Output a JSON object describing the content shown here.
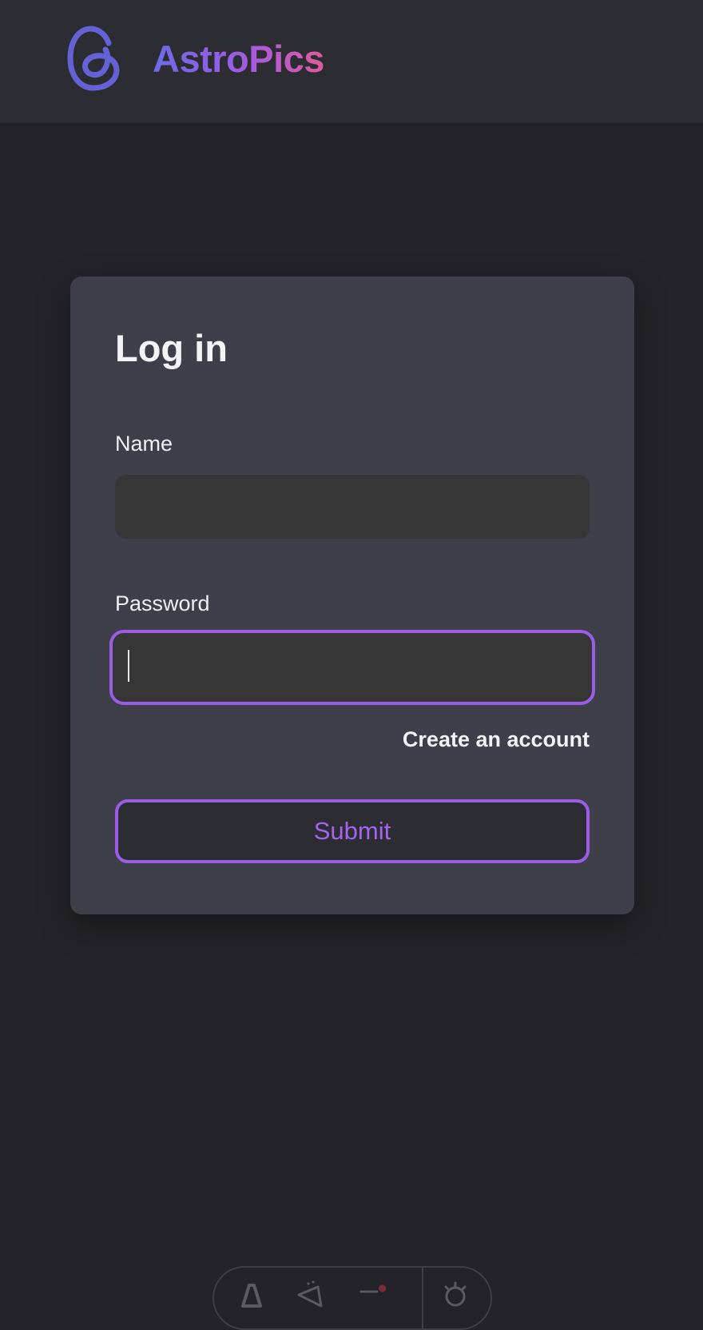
{
  "header": {
    "brand_name": "AstroPics",
    "logo_icon": "threads-at-icon",
    "brand_gradient": [
      "#6b6be6",
      "#a25be3",
      "#e05b9c"
    ]
  },
  "login": {
    "title": "Log in",
    "name_label": "Name",
    "name_value": "",
    "password_label": "Password",
    "password_value": "",
    "create_account_link": "Create an account",
    "submit_label": "Submit"
  },
  "toolbar": {
    "icons": [
      "astro-logo-icon",
      "audit-icon",
      "inspect-icon",
      "settings-gear-icon"
    ]
  },
  "colors": {
    "page_background": "#232329",
    "header_background": "#2c2c33",
    "card_background": "#3e3f49",
    "input_background": "#363636",
    "accent": "#9b5de5",
    "text": "#f3f3f6"
  }
}
